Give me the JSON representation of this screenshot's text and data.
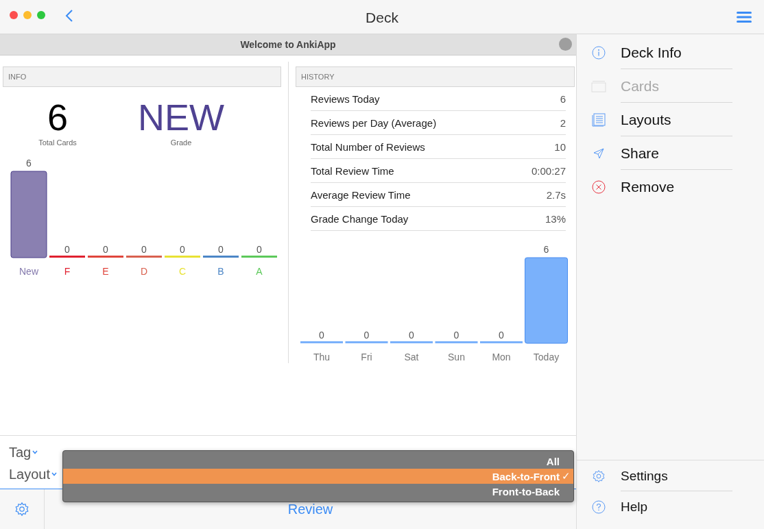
{
  "window": {
    "title": "Deck"
  },
  "banner": {
    "title": "Welcome to AnkiApp"
  },
  "info": {
    "header": "INFO",
    "total": "6",
    "total_label": "Total Cards",
    "grade": "NEW",
    "grade_label": "Grade",
    "chart_data": {
      "type": "bar",
      "categories": [
        "New",
        "F",
        "E",
        "D",
        "C",
        "B",
        "A"
      ],
      "colors": [
        "#8479ad",
        "#e0212f",
        "#e0453c",
        "#d9614f",
        "#e8e234",
        "#4c86c6",
        "#5cc95a"
      ],
      "values": [
        6,
        0,
        0,
        0,
        0,
        0,
        0
      ],
      "data_labels": true
    }
  },
  "history": {
    "header": "HISTORY",
    "rows": [
      {
        "label": "Reviews Today",
        "value": "6"
      },
      {
        "label": "Reviews per Day (Average)",
        "value": "2"
      },
      {
        "label": "Total Number of Reviews",
        "value": "10"
      },
      {
        "label": "Total Review Time",
        "value": "0:00:27"
      },
      {
        "label": "Average Review Time",
        "value": "2.7s"
      },
      {
        "label": "Grade Change Today",
        "value": "13%"
      }
    ],
    "chart_data": {
      "type": "bar",
      "categories": [
        "Thu",
        "Fri",
        "Sat",
        "Sun",
        "Mon",
        "Today"
      ],
      "color": "#7ab1fb",
      "values": [
        0,
        0,
        0,
        0,
        0,
        6
      ],
      "data_labels": true
    }
  },
  "options": [
    {
      "label": "Tag"
    },
    {
      "label": "Layout"
    }
  ],
  "dropdown": [
    {
      "label": "All",
      "selected": false
    },
    {
      "label": "Back-to-Front",
      "selected": true
    },
    {
      "label": "Front-to-Back",
      "selected": false
    }
  ],
  "check": "✓",
  "review_button": "Review",
  "sidebar": {
    "items": [
      {
        "kind": "info",
        "label": "Deck Info",
        "disabled": false
      },
      {
        "kind": "cards",
        "label": "Cards",
        "disabled": true
      },
      {
        "kind": "layouts",
        "label": "Layouts",
        "disabled": false
      },
      {
        "kind": "share",
        "label": "Share",
        "disabled": false
      },
      {
        "kind": "remove",
        "label": "Remove",
        "disabled": false
      }
    ],
    "footer": [
      {
        "kind": "settings",
        "label": "Settings",
        "disabled": false
      },
      {
        "kind": "help",
        "label": "Help",
        "disabled": false
      }
    ]
  }
}
